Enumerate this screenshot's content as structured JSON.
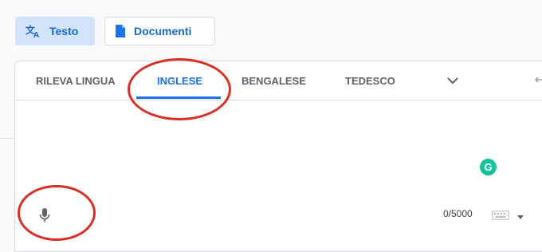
{
  "modes": {
    "text_label": "Testo",
    "documents_label": "Documenti"
  },
  "language_tabs": {
    "detect": "RILEVA LINGUA",
    "english": "INGLESE",
    "bengali": "BENGALESE",
    "german": "TEDESCO"
  },
  "grammarly_letter": "G",
  "char_counter": "0/5000",
  "colors": {
    "accent_blue": "#1a73e8",
    "active_mode_bg": "#d2e3fc",
    "annotation_red": "#d93025",
    "grammarly_green": "#15c39a"
  },
  "icons": {
    "text_mode": "translate-icon",
    "documents_mode": "document-icon",
    "more_languages": "chevron-down-icon",
    "swap": "swap-arrows-icon",
    "voice": "microphone-icon",
    "keyboard": "keyboard-icon"
  }
}
